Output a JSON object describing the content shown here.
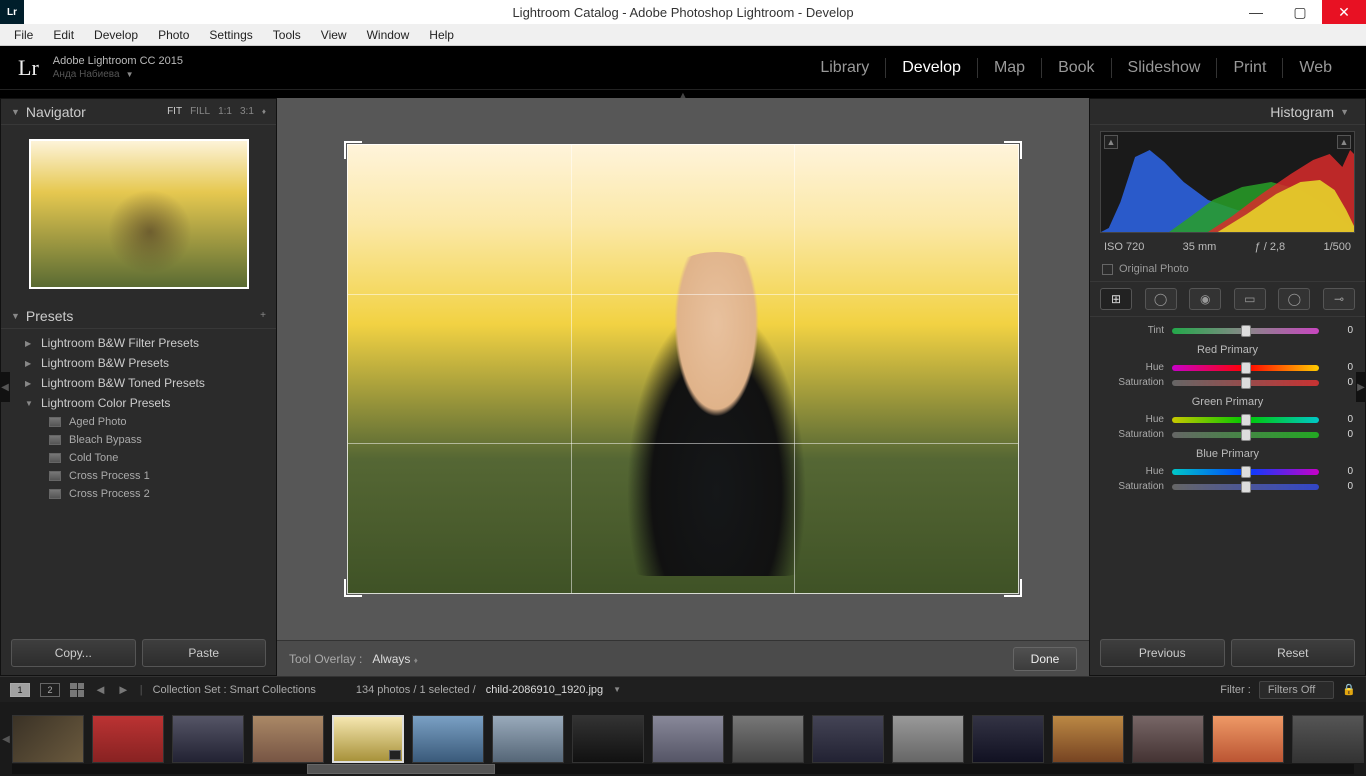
{
  "titlebar": {
    "app_icon": "Lr",
    "title": "Lightroom Catalog - Adobe Photoshop Lightroom - Develop"
  },
  "menubar": [
    "File",
    "Edit",
    "Develop",
    "Photo",
    "Settings",
    "Tools",
    "View",
    "Window",
    "Help"
  ],
  "modulebar": {
    "logo": "Lr",
    "catalog": "Adobe Lightroom CC 2015",
    "user": "Анда Набиева",
    "modules": [
      "Library",
      "Develop",
      "Map",
      "Book",
      "Slideshow",
      "Print",
      "Web"
    ],
    "active": "Develop"
  },
  "navigator": {
    "title": "Navigator",
    "zoom": [
      "FIT",
      "FILL",
      "1:1",
      "3:1"
    ],
    "zoom_sel": "FIT"
  },
  "presets": {
    "title": "Presets",
    "groups": [
      {
        "label": "Lightroom B&W Filter Presets",
        "open": false
      },
      {
        "label": "Lightroom B&W Presets",
        "open": false
      },
      {
        "label": "Lightroom B&W Toned Presets",
        "open": false
      },
      {
        "label": "Lightroom Color Presets",
        "open": true,
        "items": [
          "Aged Photo",
          "Bleach Bypass",
          "Cold Tone",
          "Cross Process 1",
          "Cross Process 2"
        ]
      }
    ]
  },
  "cp": {
    "copy": "Copy...",
    "paste": "Paste"
  },
  "center": {
    "overlay_label": "Tool Overlay :",
    "overlay_value": "Always",
    "done": "Done"
  },
  "histogram": {
    "title": "Histogram",
    "exif": {
      "iso": "ISO 720",
      "focal": "35 mm",
      "aperture": "ƒ / 2,8",
      "shutter": "1/500"
    },
    "original": "Original Photo"
  },
  "calibration": {
    "tint": {
      "label": "Tint",
      "value": "0"
    },
    "sections": [
      {
        "title": "Red Primary",
        "hue": "0",
        "sat": "0",
        "hue_cls": "grad-hue-r",
        "sat_cls": "grad-sat"
      },
      {
        "title": "Green Primary",
        "hue": "0",
        "sat": "0",
        "hue_cls": "grad-hue-g",
        "sat_cls": "grad-sat-g"
      },
      {
        "title": "Blue Primary",
        "hue": "0",
        "sat": "0",
        "hue_cls": "grad-hue-b",
        "sat_cls": "grad-sat-b"
      }
    ],
    "labels": {
      "hue": "Hue",
      "saturation": "Saturation"
    }
  },
  "prev_reset": {
    "previous": "Previous",
    "reset": "Reset"
  },
  "infobar": {
    "monitors": [
      "1",
      "2"
    ],
    "collection_label": "Collection Set : Smart Collections",
    "count": "134 photos / 1 selected /",
    "filename": "child-2086910_1920.jpg",
    "filter_label": "Filter :",
    "filter_value": "Filters Off"
  },
  "filmstrip": {
    "count": 18,
    "selected": 4
  }
}
